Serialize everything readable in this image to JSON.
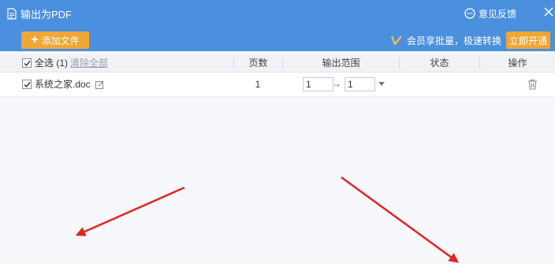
{
  "window": {
    "title": "输出为PDF",
    "feedback_label": "意见反馈"
  },
  "toolbar": {
    "add_file_label": "添加文件",
    "vip_text": "会员享批量，极速转换",
    "vip_button_label": "立即开通"
  },
  "table": {
    "select_all_label": "全选 (1)",
    "clear_all_label": "清除全部",
    "columns": [
      "页数",
      "输出范围",
      "状态",
      "操作"
    ],
    "rows": [
      {
        "checked": true,
        "filename": "系统之家.doc",
        "pages": "1",
        "range_from": "1",
        "range_to": "1",
        "status": ""
      }
    ]
  },
  "colors": {
    "header_blue": "#4a90df",
    "button_orange": "#f0a635",
    "annotation_red": "#e32424"
  }
}
